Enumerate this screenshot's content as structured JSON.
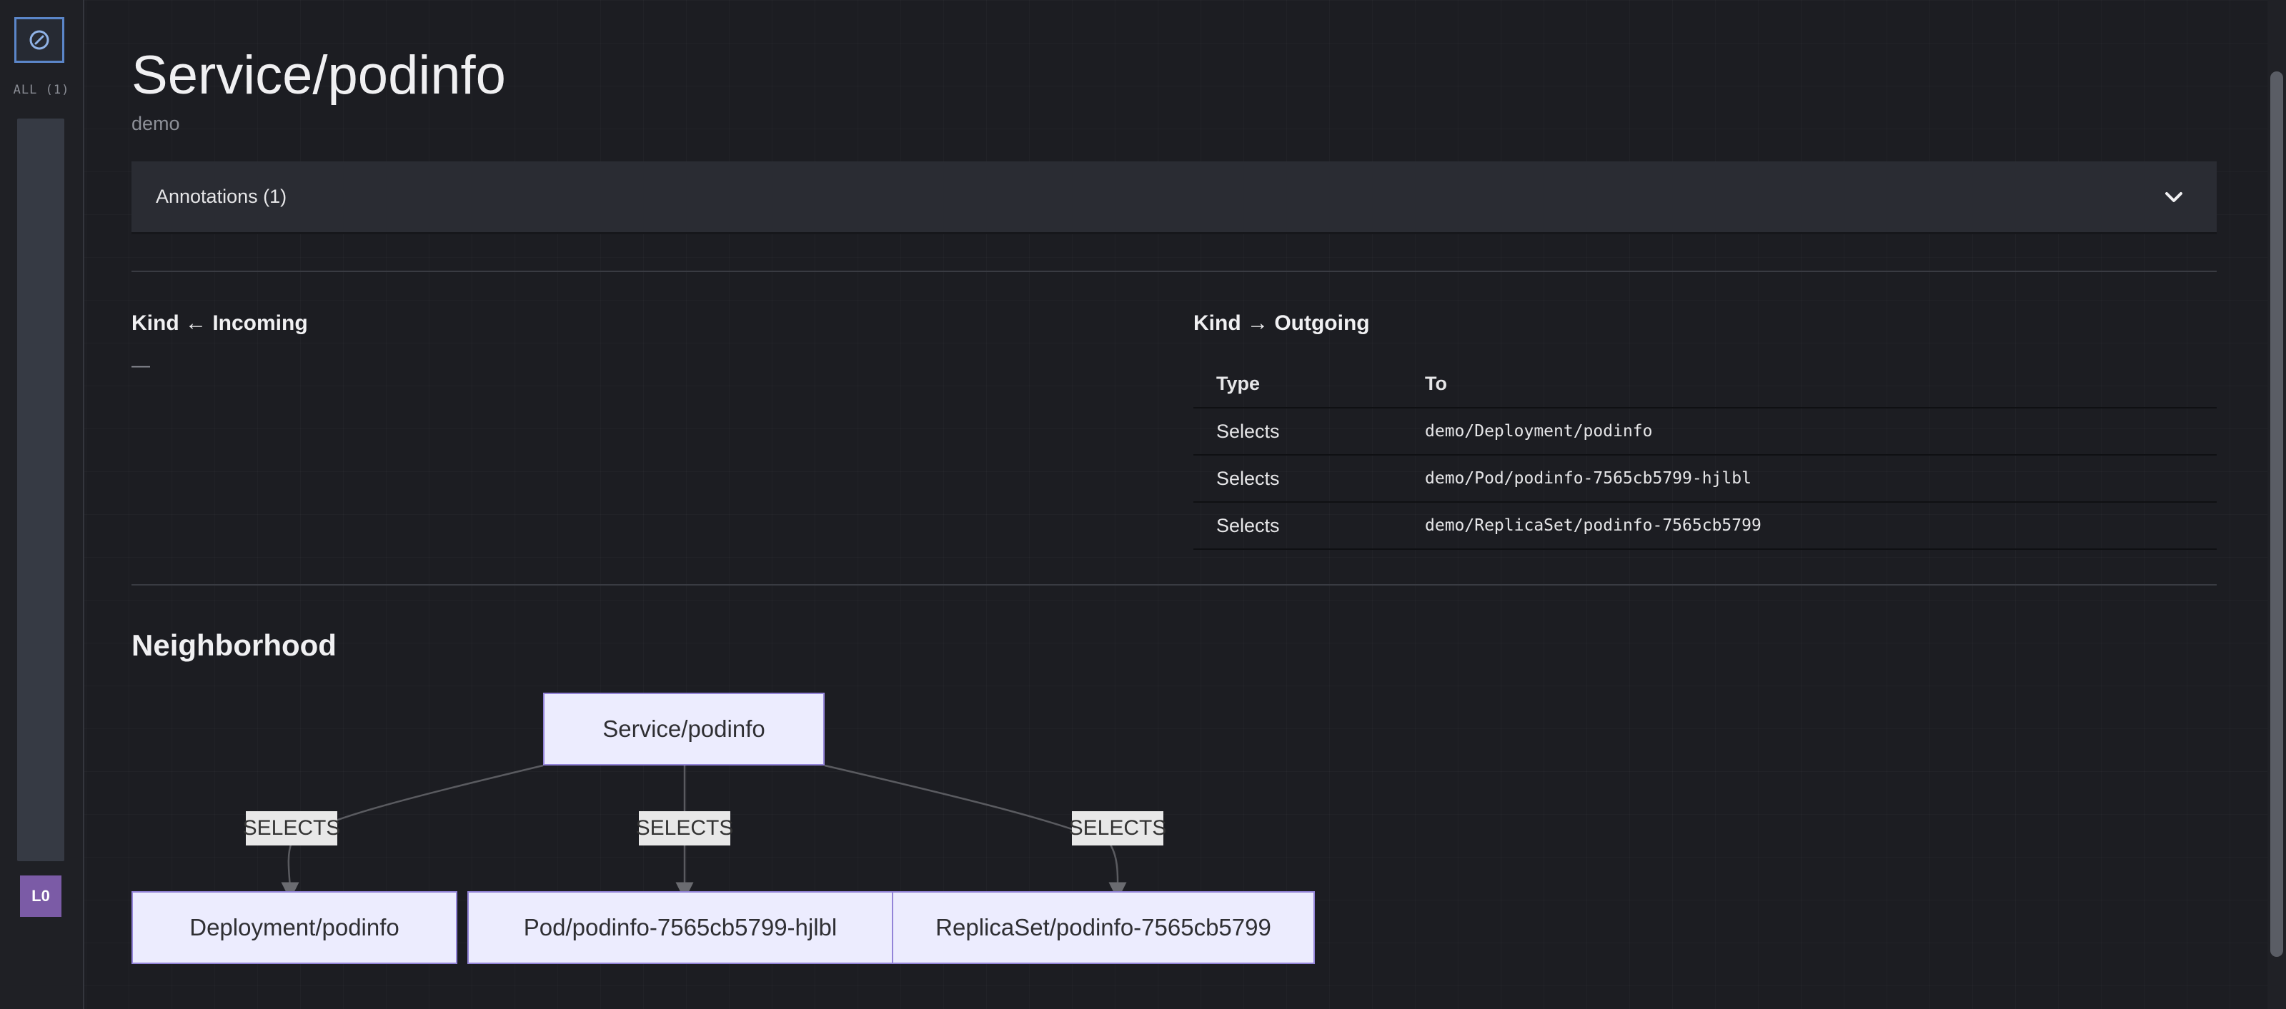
{
  "rail": {
    "all_label": "ALL (1)",
    "toggle_icon": "compass-icon",
    "badge": "L0"
  },
  "header": {
    "title": "Service/podinfo",
    "namespace": "demo"
  },
  "annotations": {
    "label": "Annotations (1)",
    "icon": "chevron-down-icon"
  },
  "incoming": {
    "heading": "Kind ← Incoming",
    "empty": "—"
  },
  "outgoing": {
    "heading": "Kind → Outgoing",
    "columns": [
      "Type",
      "To"
    ],
    "rows": [
      {
        "type": "Selects",
        "to": "demo/Deployment/podinfo"
      },
      {
        "type": "Selects",
        "to": "demo/Pod/podinfo-7565cb5799-hjlbl"
      },
      {
        "type": "Selects",
        "to": "demo/ReplicaSet/podinfo-7565cb5799"
      }
    ]
  },
  "neighborhood": {
    "heading": "Neighborhood",
    "root": "Service/podinfo",
    "edges": [
      {
        "label": "SELECTS",
        "target": "Deployment/podinfo"
      },
      {
        "label": "SELECTS",
        "target": "Pod/podinfo-7565cb5799-hjlbl"
      },
      {
        "label": "SELECTS",
        "target": "ReplicaSet/podinfo-7565cb5799"
      }
    ]
  },
  "colors": {
    "node_fill": "#ececfe",
    "node_border": "#9384d8",
    "badge": "#7b5ba6",
    "toggle_border": "#5b86c9"
  }
}
